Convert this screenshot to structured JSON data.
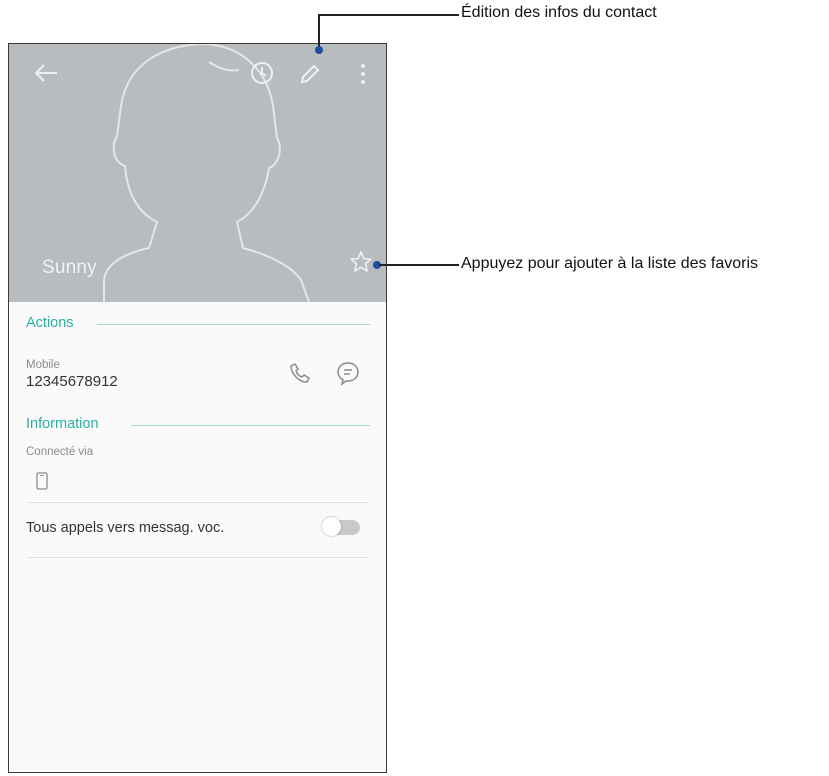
{
  "contact": {
    "name": "Sunny"
  },
  "sections": {
    "actions_title": "Actions",
    "information_title": "Information"
  },
  "phone_entry": {
    "type_label": "Mobile",
    "number": "12345678912"
  },
  "connected": {
    "label": "Connecté via"
  },
  "voicemail_setting": {
    "label": "Tous appels vers messag. voc.",
    "enabled": false
  },
  "annotations": {
    "edit_contact": "Édition des infos du contact",
    "add_favorite": "Appuyez pour ajouter à la liste des favoris"
  },
  "icons": {
    "back": "back-arrow-icon",
    "history": "clock-icon",
    "edit": "pencil-icon",
    "more": "more-vert-icon",
    "favorite": "star-icon",
    "call": "phone-icon",
    "message": "message-icon",
    "device": "device-icon"
  },
  "colors": {
    "header_bg": "#b8bcbf",
    "accent": "#2bb0a6",
    "callout_dot": "#1f4e9c"
  }
}
